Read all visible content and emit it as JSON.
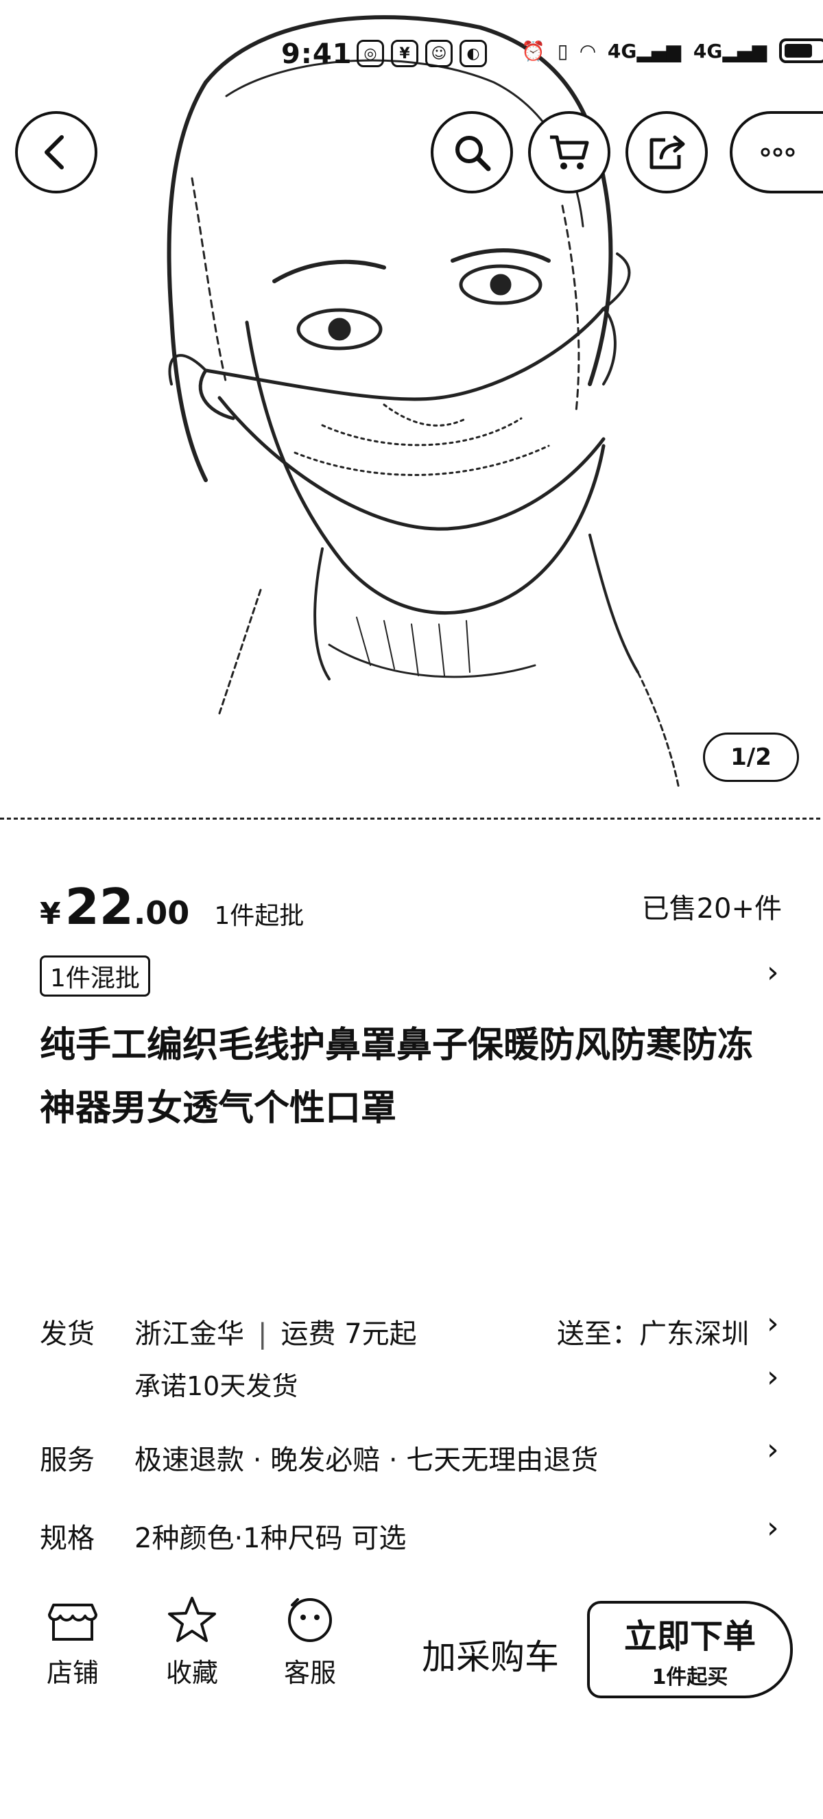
{
  "status_bar": {
    "time": "9:41",
    "network_1": "4G",
    "network_2": "4G"
  },
  "header": {
    "back_icon": "chevron-left-icon",
    "search_icon": "search-icon",
    "cart_icon": "cart-icon",
    "share_icon": "share-icon",
    "more_icon": "more-icon"
  },
  "gallery": {
    "page_indicator": "1/2"
  },
  "price": {
    "currency": "¥",
    "integer": "22",
    "decimal": ".00",
    "min_order": "1件起批",
    "sold": "已售20+件"
  },
  "tag": {
    "label": "1件混批"
  },
  "title": "纯手工编织毛线护鼻罩鼻子保暖防风防寒防冻神器男女透气个性口罩",
  "shipping": {
    "label": "发货",
    "origin": "浙江金华",
    "fee": "运费 7元起",
    "destination": "送至：广东深圳",
    "promise": "承诺10天发货"
  },
  "service": {
    "label": "服务",
    "items": "极速退款 · 晚发必赔 · 七天无理由退货"
  },
  "spec": {
    "label": "规格",
    "summary": "2种颜色·1种尺码 可选"
  },
  "bottom_bar": {
    "store": "店铺",
    "favorite": "收藏",
    "service": "客服",
    "add_to_cart": "加采购车",
    "buy_now": "立即下单",
    "buy_now_sub": "1件起买"
  },
  "colors": {
    "ink": "#111111",
    "background": "#ffffff"
  }
}
